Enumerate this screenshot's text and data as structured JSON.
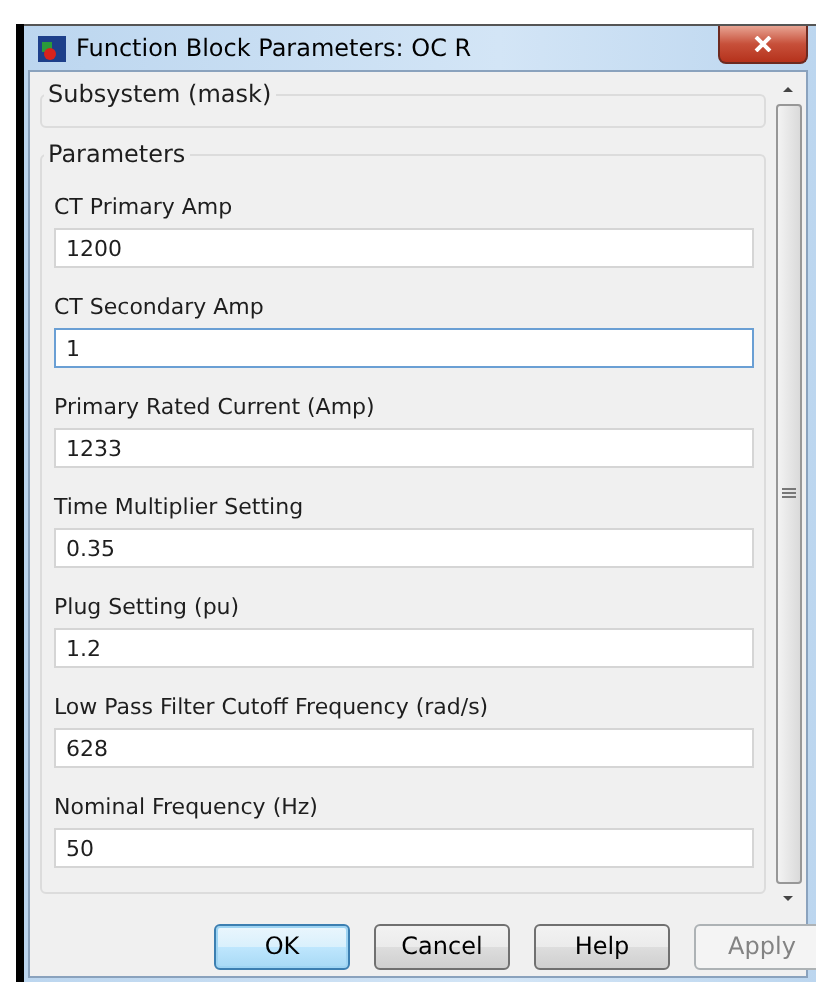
{
  "window": {
    "title": "Function Block Parameters: OC R"
  },
  "mask_group": {
    "title": "Subsystem (mask)"
  },
  "parameters": {
    "title": "Parameters",
    "fields": [
      {
        "label": "CT Primary Amp",
        "value": "1200",
        "focused": false
      },
      {
        "label": "CT Secondary Amp",
        "value": "1",
        "focused": true
      },
      {
        "label": "Primary Rated Current (Amp)",
        "value": "1233",
        "focused": false
      },
      {
        "label": "Time Multiplier Setting",
        "value": "0.35",
        "focused": false
      },
      {
        "label": "Plug Setting (pu)",
        "value": "1.2",
        "focused": false
      },
      {
        "label": "Low Pass Filter Cutoff Frequency (rad/s)",
        "value": "628",
        "focused": false
      },
      {
        "label": "Nominal Frequency (Hz)",
        "value": "50",
        "focused": false
      }
    ]
  },
  "buttons": [
    {
      "label": "OK",
      "default": true,
      "disabled": false
    },
    {
      "label": "Cancel",
      "default": false,
      "disabled": false
    },
    {
      "label": "Help",
      "default": false,
      "disabled": false
    },
    {
      "label": "Apply",
      "default": false,
      "disabled": true
    }
  ]
}
